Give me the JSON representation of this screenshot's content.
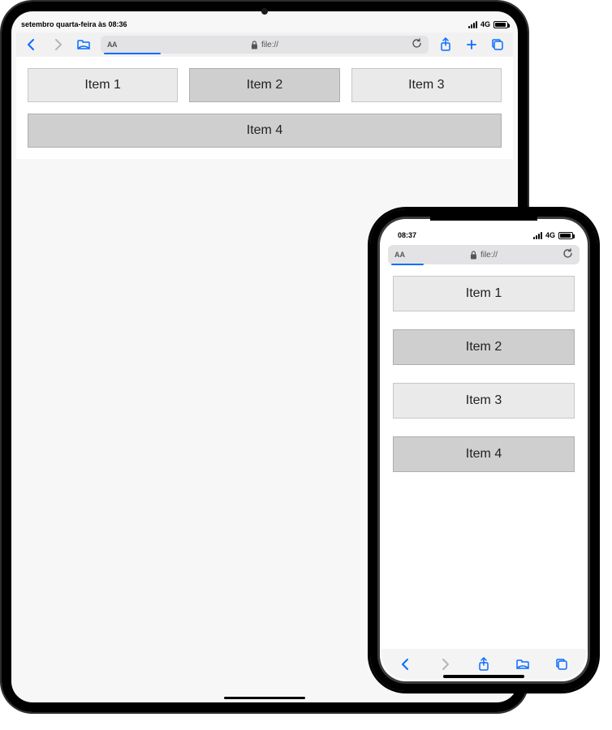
{
  "ipad": {
    "status": {
      "datetime": "setembro quarta-feira às 08:36",
      "network": "4G"
    },
    "url": {
      "aa": "AA",
      "scheme": "file://"
    },
    "items": {
      "row1": [
        {
          "label": "Item 1",
          "shade": "light"
        },
        {
          "label": "Item 2",
          "shade": "dark"
        },
        {
          "label": "Item 3",
          "shade": "light"
        }
      ],
      "row2": {
        "label": "Item 4",
        "shade": "dark"
      }
    }
  },
  "iphone": {
    "status": {
      "time": "08:37",
      "network": "4G"
    },
    "url": {
      "aa": "AA",
      "scheme": "file://"
    },
    "items": [
      {
        "label": "Item 1",
        "shade": "light"
      },
      {
        "label": "Item 2",
        "shade": "dark"
      },
      {
        "label": "Item 3",
        "shade": "light"
      },
      {
        "label": "Item 4",
        "shade": "dark"
      }
    ]
  }
}
